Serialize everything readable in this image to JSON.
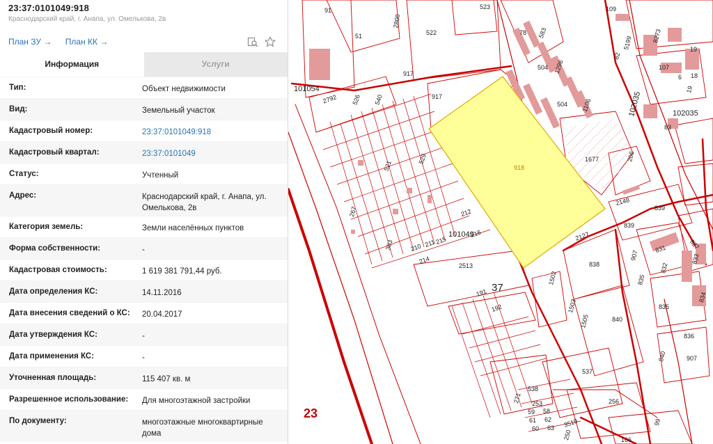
{
  "header": {
    "cadastral_number": "23:37:0101049:918",
    "address": "Краснодарский край, г. Анапа, ул. Омелькова, 2в"
  },
  "links": {
    "plan_zu": "План ЗУ →",
    "plan_kk": "План КК →"
  },
  "icons": {
    "search": "search-document-icon",
    "favorite": "star-icon"
  },
  "tabs": {
    "info": "Информация",
    "services": "Услуги"
  },
  "rows": [
    {
      "key": "Тип:",
      "value": "Объект недвижимости"
    },
    {
      "key": "Вид:",
      "value": "Земельный участок"
    },
    {
      "key": "Кадастровый номер:",
      "value": "23:37:0101049:918"
    },
    {
      "key": "Кадастровый квартал:",
      "value": "23:37:0101049"
    },
    {
      "key": "Статус:",
      "value": "Учтенный"
    },
    {
      "key": "Адрес:",
      "value": "Краснодарский край, г. Анапа, ул. Омелькова, 2в"
    },
    {
      "key": "Категория земель:",
      "value": "Земли населённых пунктов"
    },
    {
      "key": "Форма собственности:",
      "value": "-"
    },
    {
      "key": "Кадастровая стоимость:",
      "value": "1 619 381 791,44 руб."
    },
    {
      "key": "Дата определения КС:",
      "value": "14.11.2016"
    },
    {
      "key": "Дата внесения сведений о КС:",
      "value": "20.04.2017"
    },
    {
      "key": "Дата утверждения КС:",
      "value": "-"
    },
    {
      "key": "Дата применения КС:",
      "value": "-"
    },
    {
      "key": "Уточненная площадь:",
      "value": "115 407 кв. м"
    },
    {
      "key": "Разрешенное использование:",
      "value": "Для многоэтажной застройки"
    },
    {
      "key": "По документу:",
      "value": "многоэтажные многоквартирные дома"
    }
  ],
  "map": {
    "selected_parcel": "918",
    "quarter_label": "101049",
    "district_label": "37",
    "region_label": "23",
    "highlight_color": "#ffff99",
    "line_color": "#cc0000",
    "labels": [
      {
        "text": "91"
      },
      {
        "text": "51"
      },
      {
        "text": "2800"
      },
      {
        "text": "522"
      },
      {
        "text": "523"
      },
      {
        "text": "78"
      },
      {
        "text": "583"
      },
      {
        "text": "504"
      },
      {
        "text": "1296"
      },
      {
        "text": "504"
      },
      {
        "text": "1106"
      },
      {
        "text": "917"
      },
      {
        "text": "917"
      },
      {
        "text": "101054"
      },
      {
        "text": "2792"
      },
      {
        "text": "526"
      },
      {
        "text": "540"
      },
      {
        "text": "521"
      },
      {
        "text": "529"
      },
      {
        "text": "1677"
      },
      {
        "text": "206"
      },
      {
        "text": "2148"
      },
      {
        "text": "839"
      },
      {
        "text": "839"
      },
      {
        "text": "212"
      },
      {
        "text": "2127"
      },
      {
        "text": "303"
      },
      {
        "text": "210"
      },
      {
        "text": "211"
      },
      {
        "text": "215"
      },
      {
        "text": "216"
      },
      {
        "text": "214"
      },
      {
        "text": "2513"
      },
      {
        "text": "838"
      },
      {
        "text": "831"
      },
      {
        "text": "827"
      },
      {
        "text": "907"
      },
      {
        "text": "835"
      },
      {
        "text": "832"
      },
      {
        "text": "833"
      },
      {
        "text": "835"
      },
      {
        "text": "834"
      },
      {
        "text": "191"
      },
      {
        "text": "192"
      },
      {
        "text": "1502"
      },
      {
        "text": "1503"
      },
      {
        "text": "1505"
      },
      {
        "text": "840"
      },
      {
        "text": "836"
      },
      {
        "text": "840"
      },
      {
        "text": "907"
      },
      {
        "text": "537"
      },
      {
        "text": "538"
      },
      {
        "text": "271"
      },
      {
        "text": "253"
      },
      {
        "text": "59"
      },
      {
        "text": "61"
      },
      {
        "text": "60"
      },
      {
        "text": "58"
      },
      {
        "text": "62"
      },
      {
        "text": "63"
      },
      {
        "text": "250"
      },
      {
        "text": "3510"
      },
      {
        "text": "256"
      },
      {
        "text": "166"
      },
      {
        "text": "99"
      },
      {
        "text": "267"
      },
      {
        "text": "109"
      },
      {
        "text": "5199"
      },
      {
        "text": "8273"
      },
      {
        "text": "19"
      },
      {
        "text": "82"
      },
      {
        "text": "107"
      },
      {
        "text": "6"
      },
      {
        "text": "18"
      },
      {
        "text": "19"
      },
      {
        "text": "102035"
      },
      {
        "text": "102035"
      },
      {
        "text": "83"
      }
    ]
  }
}
